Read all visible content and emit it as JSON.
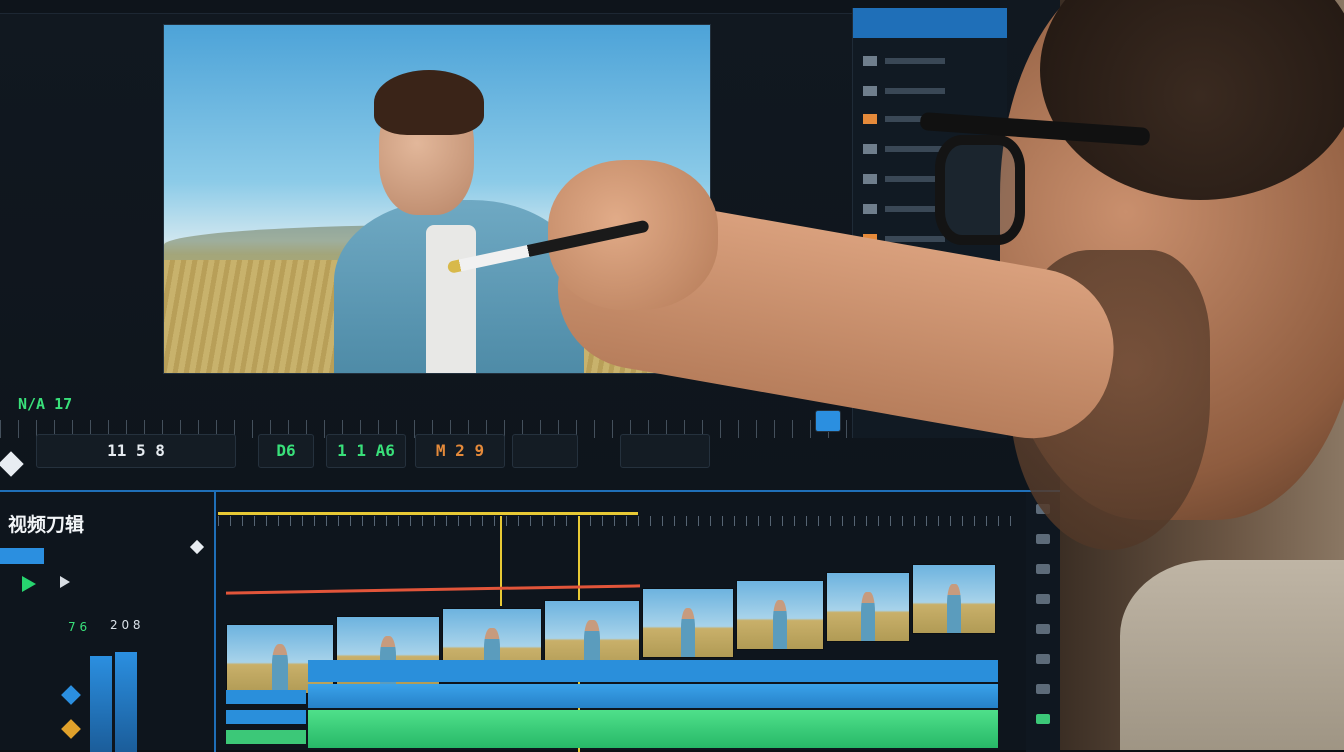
{
  "viewer": {
    "status_code": "N/A 17"
  },
  "timecodes": {
    "tc1": "11 5 8",
    "tc2": "D6",
    "tc3": "1 1 A6",
    "tc4": "M 2 9"
  },
  "editor": {
    "panel_title": "视频刀辑",
    "left_numbers": [
      "7 6",
      "2 0 8"
    ]
  },
  "colors": {
    "accent_blue": "#1f6fb8",
    "green": "#39e07a",
    "orange": "#e58a3a",
    "playhead": "#e8c935"
  }
}
